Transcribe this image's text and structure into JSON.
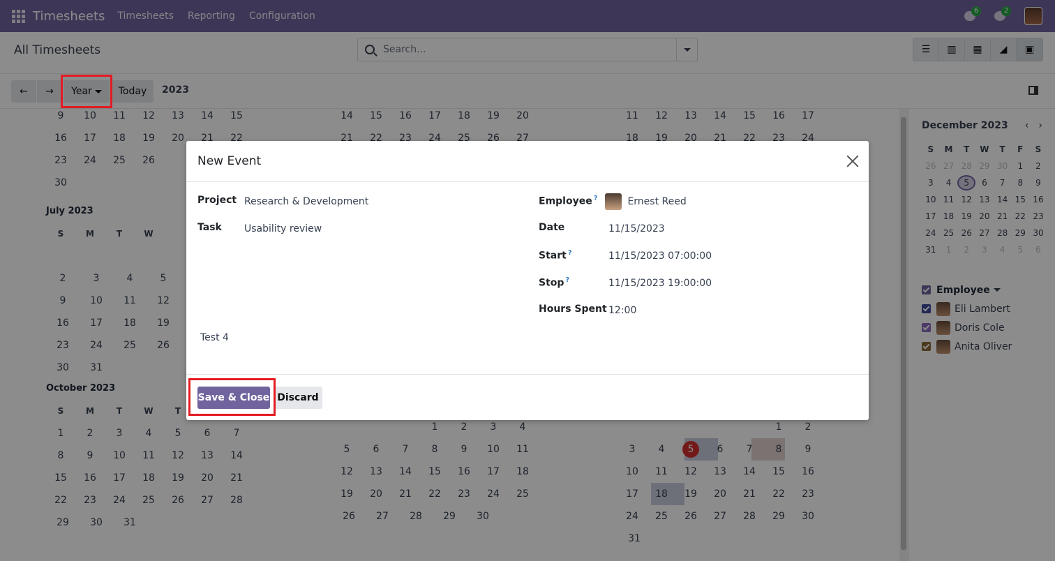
{
  "topbar": {
    "app_name": "Timesheets",
    "menu": [
      "Timesheets",
      "Reporting",
      "Configuration"
    ],
    "messages_badge": "6",
    "activities_badge": "2"
  },
  "control": {
    "breadcrumb": "All Timesheets",
    "search_placeholder": "Search..."
  },
  "calendar_bar": {
    "scale_label": "Year",
    "today_label": "Today",
    "period_label": "2023"
  },
  "calendar": {
    "weekdays": [
      "S",
      "M",
      "T",
      "W",
      "T",
      "F",
      "S"
    ],
    "months": [
      {
        "name": "",
        "rows": [
          [
            "9",
            "10",
            "11",
            "12",
            "13",
            "14",
            "15"
          ],
          [
            "16",
            "17",
            "18",
            "19",
            "20",
            "21",
            "22"
          ],
          [
            "23",
            "24",
            "25",
            "26",
            "",
            "",
            ""
          ],
          [
            "30",
            "",
            "",
            "",
            "",
            "",
            ""
          ]
        ]
      },
      {
        "name": "",
        "rows": [
          [
            "",
            "",
            "",
            "",
            "14",
            "15",
            "16",
            "17",
            "18",
            "19",
            "20"
          ]
        ]
      },
      {
        "name": "July 2023",
        "rows": [
          [
            "",
            "",
            "",
            "",
            "",
            "",
            ""
          ],
          [
            "2",
            "3",
            "4",
            "5",
            "",
            "",
            ""
          ],
          [
            "9",
            "10",
            "11",
            "12",
            "",
            "",
            ""
          ],
          [
            "16",
            "17",
            "18",
            "19",
            "",
            "",
            ""
          ],
          [
            "23",
            "24",
            "25",
            "26",
            "",
            "",
            ""
          ],
          [
            "30",
            "31",
            "",
            "",
            "",
            "",
            ""
          ]
        ]
      },
      {
        "name": "October 2023",
        "rows": [
          [
            "1",
            "2",
            "3",
            "4",
            "5",
            "6",
            "7"
          ],
          [
            "8",
            "9",
            "10",
            "11",
            "12",
            "13",
            "14"
          ],
          [
            "15",
            "16",
            "17",
            "18",
            "19",
            "20",
            "21"
          ],
          [
            "22",
            "23",
            "24",
            "25",
            "26",
            "27",
            "28"
          ],
          [
            "29",
            "30",
            "31",
            "",
            "",
            "",
            ""
          ]
        ]
      }
    ],
    "col2_top": [
      [
        "14",
        "15",
        "16",
        "17",
        "18",
        "19",
        "20"
      ],
      [
        "21",
        "22",
        "23",
        "24",
        "25",
        "26",
        "27"
      ]
    ],
    "col3_top": [
      [
        "11",
        "12",
        "13",
        "14",
        "15",
        "16",
        "17"
      ],
      [
        "18",
        "19",
        "20",
        "21",
        "22",
        "23",
        "24"
      ]
    ],
    "november_rows": [
      [
        "",
        "",
        "",
        "1",
        "2",
        "3",
        "4"
      ],
      [
        "5",
        "6",
        "7",
        "8",
        "9",
        "10",
        "11"
      ],
      [
        "12",
        "13",
        "14",
        "15",
        "16",
        "17",
        "18"
      ],
      [
        "19",
        "20",
        "21",
        "22",
        "23",
        "24",
        "25"
      ],
      [
        "26",
        "27",
        "28",
        "29",
        "30",
        "",
        ""
      ]
    ],
    "december_rows": [
      [
        "",
        "",
        "",
        "",
        "",
        "1",
        "2"
      ],
      [
        "3",
        "4",
        "5",
        "6",
        "7",
        "8",
        "9"
      ],
      [
        "10",
        "11",
        "12",
        "13",
        "14",
        "15",
        "16"
      ],
      [
        "17",
        "18",
        "19",
        "20",
        "21",
        "22",
        "23"
      ],
      [
        "24",
        "25",
        "26",
        "27",
        "28",
        "29",
        "30"
      ],
      [
        "31",
        "",
        "",
        "",
        "",
        "",
        ""
      ]
    ]
  },
  "sidebar": {
    "month_title": "December 2023",
    "weekdays": [
      "S",
      "M",
      "T",
      "W",
      "T",
      "F",
      "S"
    ],
    "weeks": [
      [
        "26",
        "27",
        "28",
        "29",
        "30",
        "1",
        "2"
      ],
      [
        "3",
        "4",
        "5",
        "6",
        "7",
        "8",
        "9"
      ],
      [
        "10",
        "11",
        "12",
        "13",
        "14",
        "15",
        "16"
      ],
      [
        "17",
        "18",
        "19",
        "20",
        "21",
        "22",
        "23"
      ],
      [
        "24",
        "25",
        "26",
        "27",
        "28",
        "29",
        "30"
      ],
      [
        "31",
        "1",
        "2",
        "3",
        "4",
        "5",
        "6"
      ]
    ],
    "filter_title": "Employee",
    "employees": [
      {
        "name": "Eli Lambert",
        "color": "#3b4a9c"
      },
      {
        "name": "Doris Cole",
        "color": "#8a6bbf"
      },
      {
        "name": "Anita Oliver",
        "color": "#8b6a3a"
      }
    ]
  },
  "modal": {
    "title": "New Event",
    "project_label": "Project",
    "project_value": "Research & Development",
    "task_label": "Task",
    "task_value": "Usability review",
    "employee_label": "Employee",
    "employee_value": "Ernest Reed",
    "date_label": "Date",
    "date_value": "11/15/2023",
    "start_label": "Start",
    "start_value": "11/15/2023 07:00:00",
    "stop_label": "Stop",
    "stop_value": "11/15/2023 19:00:00",
    "hours_label": "Hours Spent",
    "hours_value": "12:00",
    "description": "Test 4",
    "save_label": "Save & Close",
    "discard_label": "Discard"
  },
  "colors": {
    "brand": "#71639e",
    "highlight": "#e31b23",
    "today_badge": "#d32f2f"
  }
}
